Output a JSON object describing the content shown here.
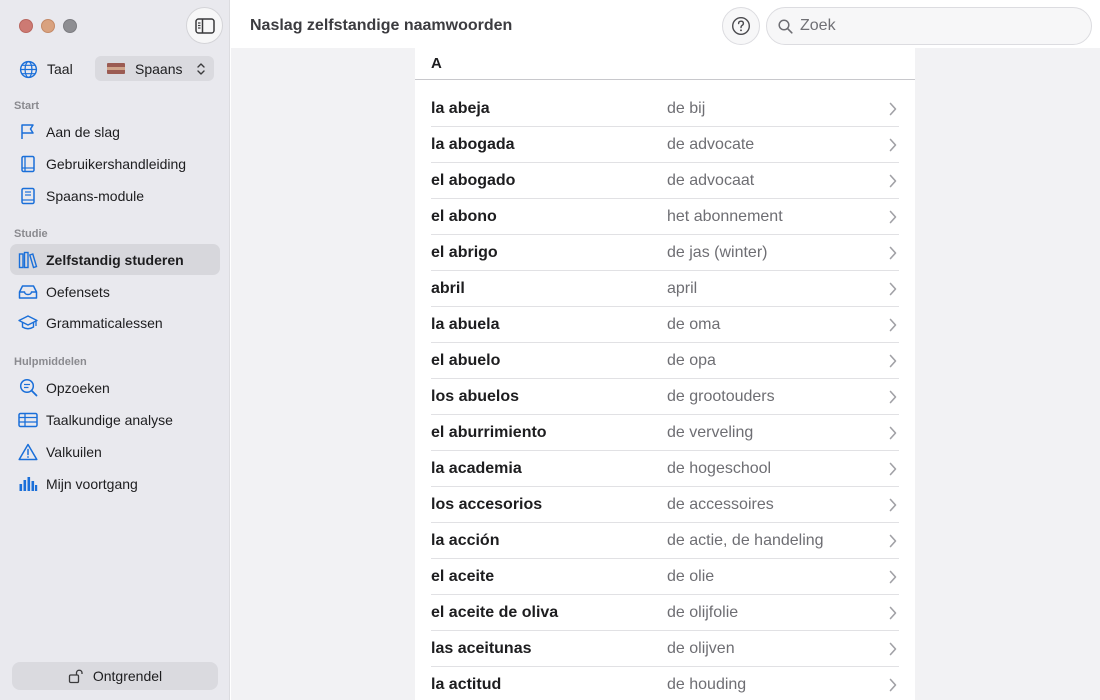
{
  "sidebar": {
    "language_label": "Taal",
    "language_value": "Spaans",
    "sections": [
      {
        "title": "Start"
      },
      {
        "title": "Studie"
      },
      {
        "title": "Hulpmiddelen"
      }
    ],
    "items": [
      {
        "label": "Aan de slag",
        "icon": "flag-icon"
      },
      {
        "label": "Gebruikershandleiding",
        "icon": "book-icon"
      },
      {
        "label": "Spaans-module",
        "icon": "module-book-icon"
      },
      {
        "label": "Zelfstandig studeren",
        "icon": "library-icon",
        "active": true
      },
      {
        "label": "Oefensets",
        "icon": "tray-icon"
      },
      {
        "label": "Grammaticalessen",
        "icon": "graduation-cap-icon"
      },
      {
        "label": "Opzoeken",
        "icon": "magnifier-text-icon"
      },
      {
        "label": "Taalkundige analyse",
        "icon": "table-icon"
      },
      {
        "label": "Valkuilen",
        "icon": "warning-triangle-icon"
      },
      {
        "label": "Mijn voortgang",
        "icon": "bar-chart-icon"
      }
    ],
    "unlock_label": "Ontgrendel"
  },
  "header": {
    "title": "Naslag zelfstandige naamwoorden",
    "search_placeholder": "Zoek"
  },
  "list": {
    "letter": "A",
    "rows": [
      {
        "es": "la abeja",
        "nl": "de bij"
      },
      {
        "es": "la abogada",
        "nl": "de advocate"
      },
      {
        "es": "el abogado",
        "nl": "de advocaat"
      },
      {
        "es": "el abono",
        "nl": "het abonnement"
      },
      {
        "es": "el abrigo",
        "nl": "de jas (winter)"
      },
      {
        "es": "abril",
        "nl": "april"
      },
      {
        "es": "la abuela",
        "nl": "de oma"
      },
      {
        "es": "el abuelo",
        "nl": "de opa"
      },
      {
        "es": "los abuelos",
        "nl": "de grootouders"
      },
      {
        "es": "el aburrimiento",
        "nl": "de verveling"
      },
      {
        "es": "la academia",
        "nl": "de hogeschool"
      },
      {
        "es": "los accesorios",
        "nl": "de accessoires"
      },
      {
        "es": "la acción",
        "nl": "de actie, de handeling"
      },
      {
        "es": "el aceite",
        "nl": "de olie"
      },
      {
        "es": "el aceite de oliva",
        "nl": "de olijfolie"
      },
      {
        "es": "las aceitunas",
        "nl": "de olijven"
      },
      {
        "es": "la actitud",
        "nl": "de houding"
      }
    ]
  },
  "colors": {
    "accent": "#1a6fd9",
    "sidebar_bg": "#e9e9ee",
    "active_bg": "#d7d7dc"
  }
}
